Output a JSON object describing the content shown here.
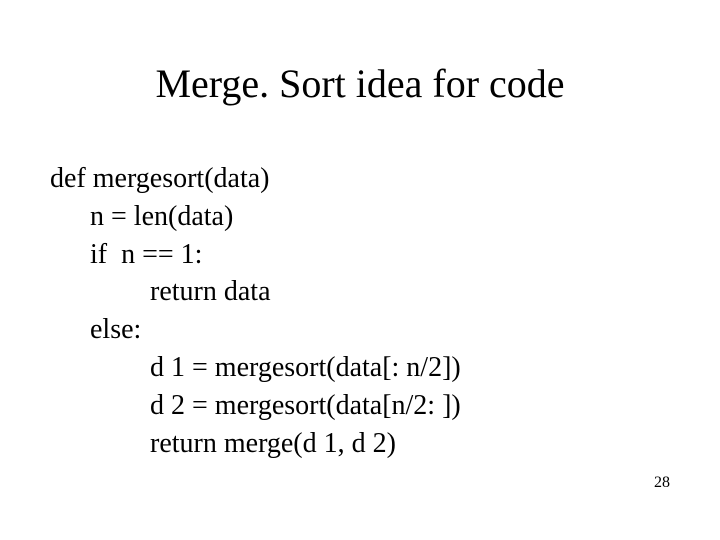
{
  "title": "Merge. Sort idea for code",
  "code": {
    "l0": "def mergesort(data)",
    "l1": "n = len(data)",
    "l2": "if  n == 1:",
    "l3": "return data",
    "l4": "else:",
    "l5": "d 1 = mergesort(data[: n/2])",
    "l6": "d 2 = mergesort(data[n/2: ])",
    "l7": "return merge(d 1, d 2)"
  },
  "page_number": "28"
}
